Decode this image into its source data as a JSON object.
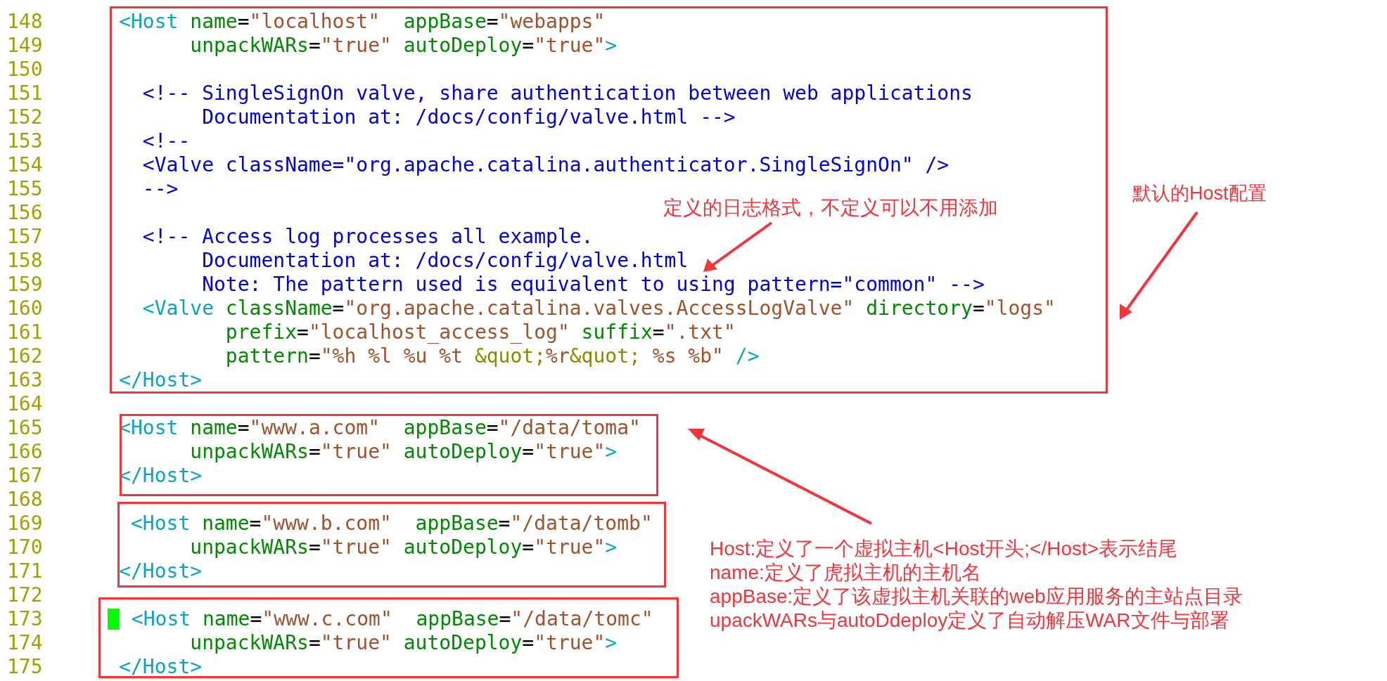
{
  "editor": {
    "lines": [
      {
        "number": "148",
        "tokens": [
          {
            "kind": "tag",
            "text": "      <Host"
          },
          {
            "kind": "attr",
            "text": " name"
          },
          {
            "kind": "plain",
            "text": "="
          },
          {
            "kind": "value",
            "text": "\"localhost\""
          },
          {
            "kind": "attr",
            "text": "  appBase"
          },
          {
            "kind": "plain",
            "text": "="
          },
          {
            "kind": "value",
            "text": "\"webapps\""
          }
        ]
      },
      {
        "number": "149",
        "tokens": [
          {
            "kind": "attr",
            "text": "            unpackWARs"
          },
          {
            "kind": "plain",
            "text": "="
          },
          {
            "kind": "value",
            "text": "\"true\""
          },
          {
            "kind": "attr",
            "text": " autoDeploy"
          },
          {
            "kind": "plain",
            "text": "="
          },
          {
            "kind": "value",
            "text": "\"true\""
          },
          {
            "kind": "tag",
            "text": ">"
          }
        ]
      },
      {
        "number": "150"
      },
      {
        "number": "151",
        "tokens": [
          {
            "kind": "comment",
            "text": "        <!-- SingleSignOn valve, share authentication between web applications"
          }
        ]
      },
      {
        "number": "152",
        "tokens": [
          {
            "kind": "comment",
            "text": "             Documentation at: /docs/config/valve.html -->"
          }
        ]
      },
      {
        "number": "153",
        "tokens": [
          {
            "kind": "comment",
            "text": "        <!--"
          }
        ]
      },
      {
        "number": "154",
        "tokens": [
          {
            "kind": "comment",
            "text": "        <Valve className=\"org.apache.catalina.authenticator.SingleSignOn\" />"
          }
        ]
      },
      {
        "number": "155",
        "tokens": [
          {
            "kind": "comment",
            "text": "        -->"
          }
        ]
      },
      {
        "number": "156"
      },
      {
        "number": "157",
        "tokens": [
          {
            "kind": "comment",
            "text": "        <!-- Access log processes all example."
          }
        ]
      },
      {
        "number": "158",
        "tokens": [
          {
            "kind": "comment",
            "text": "             Documentation at: /docs/config/valve.html"
          }
        ]
      },
      {
        "number": "159",
        "tokens": [
          {
            "kind": "comment",
            "text": "             Note: The pattern used is equivalent to using pattern=\"common\" -->"
          }
        ]
      },
      {
        "number": "160",
        "tokens": [
          {
            "kind": "tag",
            "text": "        <Valve"
          },
          {
            "kind": "attr",
            "text": " className"
          },
          {
            "kind": "plain",
            "text": "="
          },
          {
            "kind": "value",
            "text": "\"org.apache.catalina.valves.AccessLogValve\""
          },
          {
            "kind": "attr",
            "text": " directory"
          },
          {
            "kind": "plain",
            "text": "="
          },
          {
            "kind": "value",
            "text": "\"logs\""
          }
        ]
      },
      {
        "number": "161",
        "tokens": [
          {
            "kind": "attr",
            "text": "               prefix"
          },
          {
            "kind": "plain",
            "text": "="
          },
          {
            "kind": "value",
            "text": "\"localhost_access_log\""
          },
          {
            "kind": "attr",
            "text": " suffix"
          },
          {
            "kind": "plain",
            "text": "="
          },
          {
            "kind": "value",
            "text": "\".txt\""
          }
        ]
      },
      {
        "number": "162",
        "tokens": [
          {
            "kind": "attr",
            "text": "               pattern"
          },
          {
            "kind": "plain",
            "text": "="
          },
          {
            "kind": "value",
            "text": "\"%h %l %u %t "
          },
          {
            "kind": "entity",
            "text": "&quot;"
          },
          {
            "kind": "value",
            "text": "%r"
          },
          {
            "kind": "entity",
            "text": "&quot;"
          },
          {
            "kind": "value",
            "text": " %s %b\""
          },
          {
            "kind": "tag",
            "text": " />"
          }
        ]
      },
      {
        "number": "163",
        "tokens": [
          {
            "kind": "tag",
            "text": "      </Host>"
          }
        ]
      },
      {
        "number": "164"
      },
      {
        "number": "165",
        "tokens": [
          {
            "kind": "tag",
            "text": "      <Host"
          },
          {
            "kind": "attr",
            "text": " name"
          },
          {
            "kind": "plain",
            "text": "="
          },
          {
            "kind": "value",
            "text": "\"www.a.com\""
          },
          {
            "kind": "attr",
            "text": "  appBase"
          },
          {
            "kind": "plain",
            "text": "="
          },
          {
            "kind": "value",
            "text": "\"/data/toma\""
          }
        ]
      },
      {
        "number": "166",
        "tokens": [
          {
            "kind": "attr",
            "text": "            unpackWARs"
          },
          {
            "kind": "plain",
            "text": "="
          },
          {
            "kind": "value",
            "text": "\"true\""
          },
          {
            "kind": "attr",
            "text": " autoDeploy"
          },
          {
            "kind": "plain",
            "text": "="
          },
          {
            "kind": "value",
            "text": "\"true\""
          },
          {
            "kind": "tag",
            "text": ">"
          }
        ]
      },
      {
        "number": "167",
        "tokens": [
          {
            "kind": "tag",
            "text": "      </Host>"
          }
        ]
      },
      {
        "number": "168"
      },
      {
        "number": "169",
        "tokens": [
          {
            "kind": "tag",
            "text": "       <Host"
          },
          {
            "kind": "attr",
            "text": " name"
          },
          {
            "kind": "plain",
            "text": "="
          },
          {
            "kind": "value",
            "text": "\"www.b.com\""
          },
          {
            "kind": "attr",
            "text": "  appBase"
          },
          {
            "kind": "plain",
            "text": "="
          },
          {
            "kind": "value",
            "text": "\"/data/tomb\""
          }
        ]
      },
      {
        "number": "170",
        "tokens": [
          {
            "kind": "attr",
            "text": "            unpackWARs"
          },
          {
            "kind": "plain",
            "text": "="
          },
          {
            "kind": "value",
            "text": "\"true\""
          },
          {
            "kind": "attr",
            "text": " autoDeploy"
          },
          {
            "kind": "plain",
            "text": "="
          },
          {
            "kind": "value",
            "text": "\"true\""
          },
          {
            "kind": "tag",
            "text": ">"
          }
        ]
      },
      {
        "number": "171",
        "tokens": [
          {
            "kind": "tag",
            "text": "      </Host>"
          }
        ]
      },
      {
        "number": "172"
      },
      {
        "number": "173",
        "tokens": [
          {
            "kind": "cursor"
          },
          {
            "kind": "tag",
            "text": " <Host"
          },
          {
            "kind": "attr",
            "text": " name"
          },
          {
            "kind": "plain",
            "text": "="
          },
          {
            "kind": "value",
            "text": "\"www.c.com\""
          },
          {
            "kind": "attr",
            "text": "  appBase"
          },
          {
            "kind": "plain",
            "text": "="
          },
          {
            "kind": "value",
            "text": "\"/data/tomc\""
          }
        ]
      },
      {
        "number": "174",
        "tokens": [
          {
            "kind": "attr",
            "text": "            unpackWARs"
          },
          {
            "kind": "plain",
            "text": "="
          },
          {
            "kind": "value",
            "text": "\"true\""
          },
          {
            "kind": "attr",
            "text": " autoDeploy"
          },
          {
            "kind": "plain",
            "text": "="
          },
          {
            "kind": "value",
            "text": "\"true\""
          },
          {
            "kind": "tag",
            "text": ">"
          }
        ]
      },
      {
        "number": "175",
        "tokens": [
          {
            "kind": "tag",
            "text": "      </Host>"
          }
        ]
      }
    ]
  },
  "annotations": [
    {
      "text": "定义的日志格式，不定义可以不用添加"
    },
    {
      "text": "默认的Host配置"
    },
    {
      "lines": [
        "Host:定义了一个虚拟主机<Host开头;</Host>表示结尾",
        "name:定义了虎拟主机的主机名",
        "appBase:定义了该虚拟主机关联的web应用服务的主站点目录",
        "upackWARs与autoDdeploy定义了自动解压WAR文件与部署"
      ]
    }
  ]
}
